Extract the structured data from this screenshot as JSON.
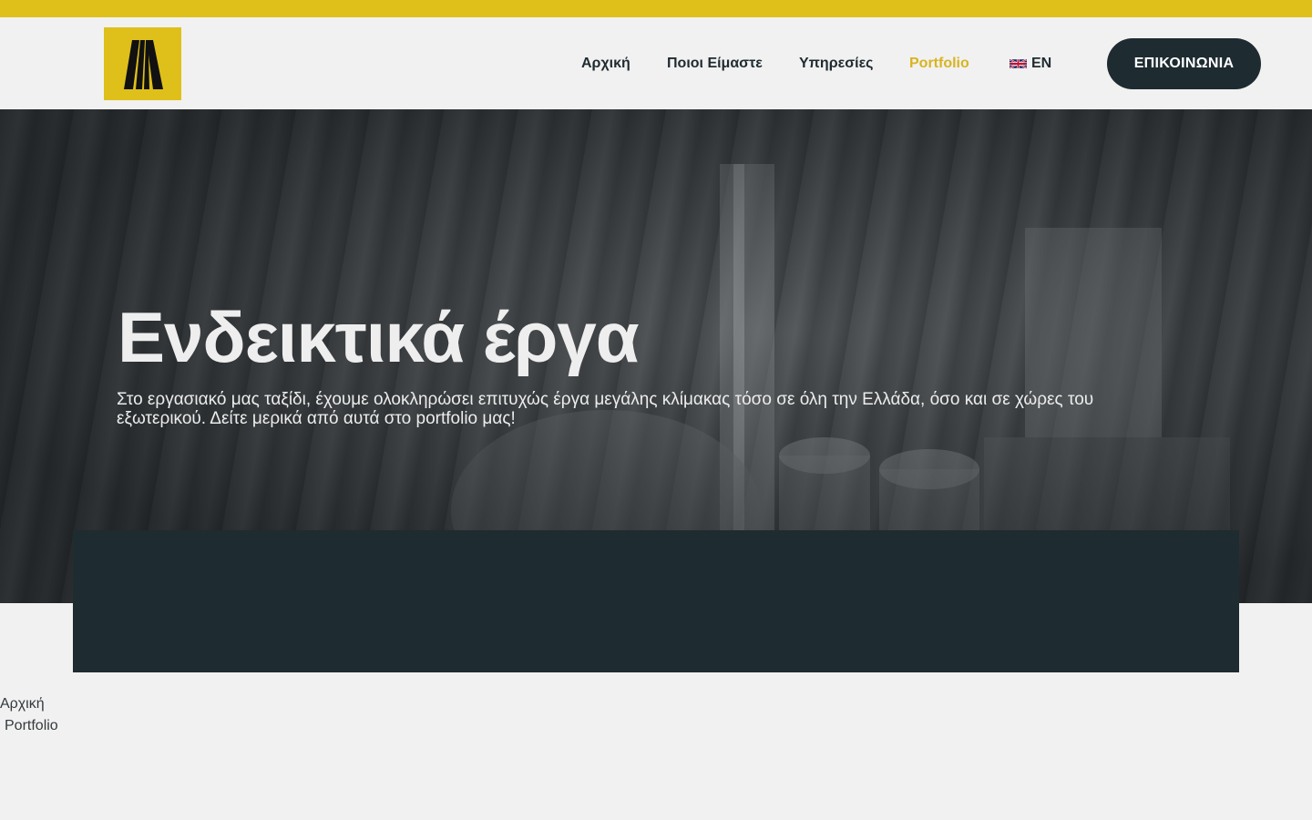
{
  "colors": {
    "accent": "#dfc01a",
    "dark": "#1e2b31",
    "nav_active": "#d8b420",
    "page_bg": "#f1f1f1"
  },
  "header": {
    "logo_icon": "company-logo-icon",
    "nav": {
      "home": "Αρχική",
      "about": "Ποιοι Είμαστε",
      "services": "Υπηρεσίες",
      "portfolio": "Portfolio",
      "language": "EN",
      "language_flag": "uk-flag-icon"
    },
    "contact_button": "ΕΠΙΚΟΙΝΩΝΙΑ"
  },
  "hero": {
    "title": "Ενδεικτικά έργα",
    "text": "Στο εργασιακό μας ταξίδι, έχουμε ολοκληρώσει επιτυχώς έργα μεγάλης κλίμακας τόσο σε όλη την Ελλάδα, όσο και σε χώρες του εξωτερικού. Δείτε μερικά από αυτά στο portfolio μας!"
  },
  "breadcrumb": {
    "home": "Αρχική",
    "current": "Portfolio"
  }
}
